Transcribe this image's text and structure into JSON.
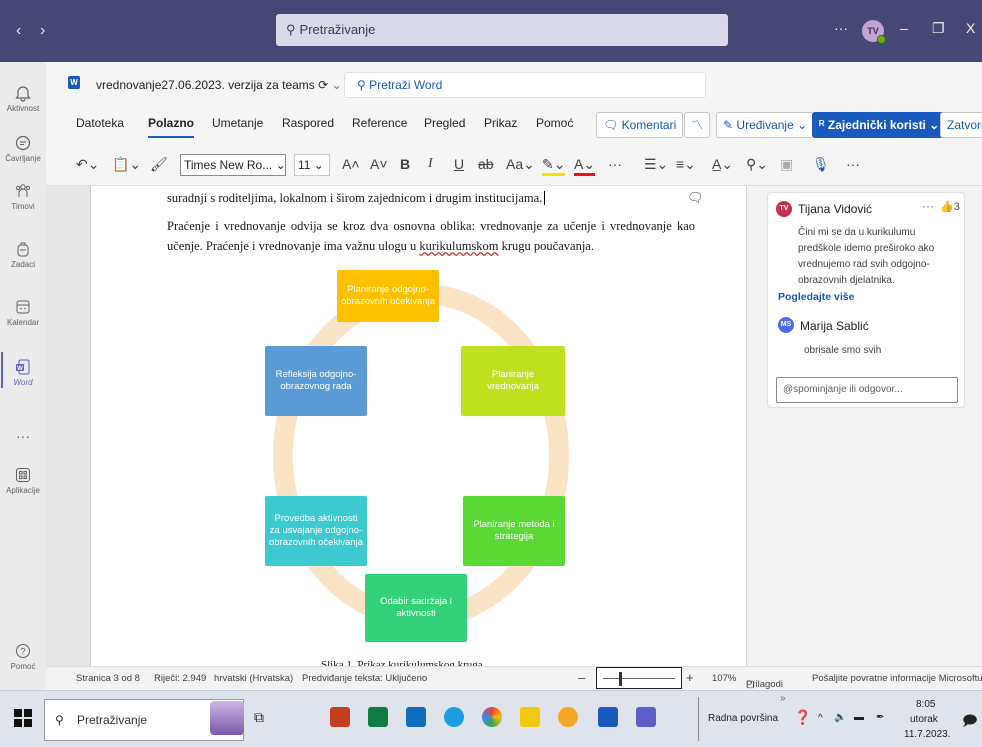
{
  "teams": {
    "search_placeholder": "Pretraživanje",
    "avatar_initials": "TV",
    "more": "···"
  },
  "rail": {
    "items": [
      {
        "label": "Aktivnost"
      },
      {
        "label": "Čavrljanje"
      },
      {
        "label": "Timovi"
      },
      {
        "label": "Zadaci"
      },
      {
        "label": "Kalendar"
      },
      {
        "label": "Word"
      },
      {
        "label": "···"
      },
      {
        "label": "Aplikacije"
      },
      {
        "label": "Pomoć"
      }
    ]
  },
  "word": {
    "doc_title": "vrednovanje27.06.2023. verzija za teams",
    "search_placeholder": "Pretraži Word",
    "tabs": [
      "Datoteka",
      "Polazno",
      "Umetanje",
      "Raspored",
      "Reference",
      "Pregled",
      "Prikaz",
      "Pomoć"
    ],
    "active_tab": "Polazno",
    "buttons": {
      "comments": "Komentari",
      "editing": "Uređivanje",
      "share": "Zajednički koristi",
      "close": "Zatvori"
    },
    "font_name": "Times New Ro...",
    "font_size": "11"
  },
  "document": {
    "line1": "suradnji s roditeljima, lokalnom i širom zajednicom i drugim institucijama.",
    "para2_a": "Praćenje i vrednovanje odvija se kroz dva osnovna oblika: vrednovanje za učenje i vrednovanje kao učenje. Praćenje i vrednovanje ima važnu ulogu u ",
    "para2_underlined": "kurikulumskom",
    "para2_b": " krugu poučavanja.",
    "caption": "Slika 1. Prikaz kurikulumskog kruga",
    "cycle": [
      {
        "label": "Planiranje odgojno-obrazovnih očekivanja",
        "color": "#ffc000"
      },
      {
        "label": "Planiranje vrednovanja",
        "color": "#bfe11d"
      },
      {
        "label": "Planiranje metoda i strategija",
        "color": "#5ad834"
      },
      {
        "label": "Odabir sadržaja i aktivnosti",
        "color": "#33d17a"
      },
      {
        "label": "Provedba aktivnosti za usvajanje odgojno-obrazovnih očekivanja",
        "color": "#3cc9cf"
      },
      {
        "label": "Refleksija odgojno-obrazovnog rada",
        "color": "#5b9bd5"
      }
    ]
  },
  "comments": {
    "author1_initials": "TV",
    "author1": "Tijana Vidović",
    "likes": "3",
    "text1": "Čini mi se da u kurikulumu predškole idemo preširoko ako vrednujemo rad svih odgojno-obrazovnih djelatnika.",
    "see_more": "Pogledajte više",
    "author2_initials": "MS",
    "author2": "Marija Sablić",
    "text2": "obrisale smo svih",
    "reply_placeholder": "@spominjanje ili odgovor..."
  },
  "status": {
    "page": "Stranica 3 od 8",
    "words": "Riječi: 2.949",
    "language": "hrvatski (Hrvatska)",
    "predictions": "Predviđanje teksta: Uključeno",
    "zoom": "107%",
    "fit": "Prilagodi",
    "feedback": "Pošaljite povratne informacije Microsoftu"
  },
  "taskbar": {
    "search": "Pretraživanje",
    "desktop": "Radna površina",
    "time": "8:05",
    "day": "utorak",
    "date": "11.7.2023."
  },
  "colors": {
    "teams_bar": "#464775",
    "word_blue": "#185abd"
  }
}
